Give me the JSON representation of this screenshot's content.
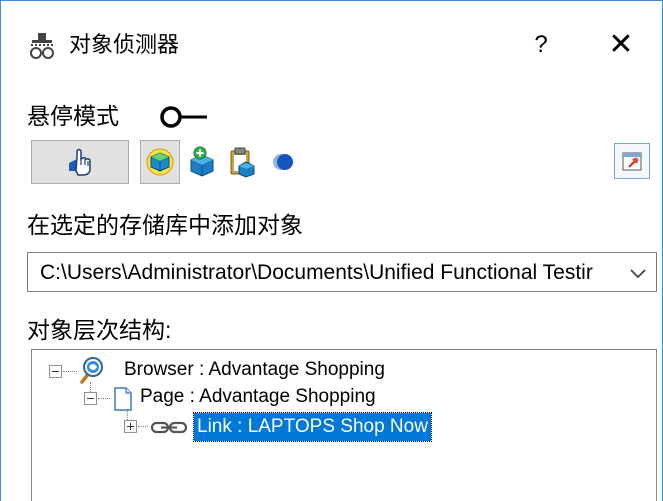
{
  "window": {
    "title": "对象侦测器",
    "help_label": "?",
    "close_label": "✕",
    "accent": "#3c8cd6"
  },
  "hover": {
    "label": "悬停模式",
    "enabled": false
  },
  "toolbar": {
    "buttons": [
      {
        "name": "pointing-hand-button",
        "icon": "pointing-hand-icon"
      },
      {
        "name": "highlight-object-button",
        "icon": "cube-highlight-icon"
      },
      {
        "name": "add-object-button",
        "icon": "cube-add-icon"
      },
      {
        "name": "copy-to-clipboard-button",
        "icon": "clipboard-icon"
      },
      {
        "name": "record-button",
        "icon": "record-icon"
      },
      {
        "name": "keep-on-top-button",
        "icon": "pin-window-icon"
      }
    ]
  },
  "repository": {
    "label": "在选定的存储库中添加对象",
    "value": "C:\\Users\\Administrator\\Documents\\Unified Functional Testir"
  },
  "hierarchy": {
    "label": "对象层次结构:",
    "nodes": [
      {
        "label": "Browser : Advantage Shopping",
        "icon": "browser-icon",
        "expanded": true
      },
      {
        "label": "Page : Advantage Shopping",
        "icon": "page-icon",
        "expanded": true
      },
      {
        "label": "Link : LAPTOPS Shop Now",
        "icon": "link-icon",
        "expanded": false,
        "selected": true
      }
    ],
    "selection_color": "#0078d7"
  }
}
